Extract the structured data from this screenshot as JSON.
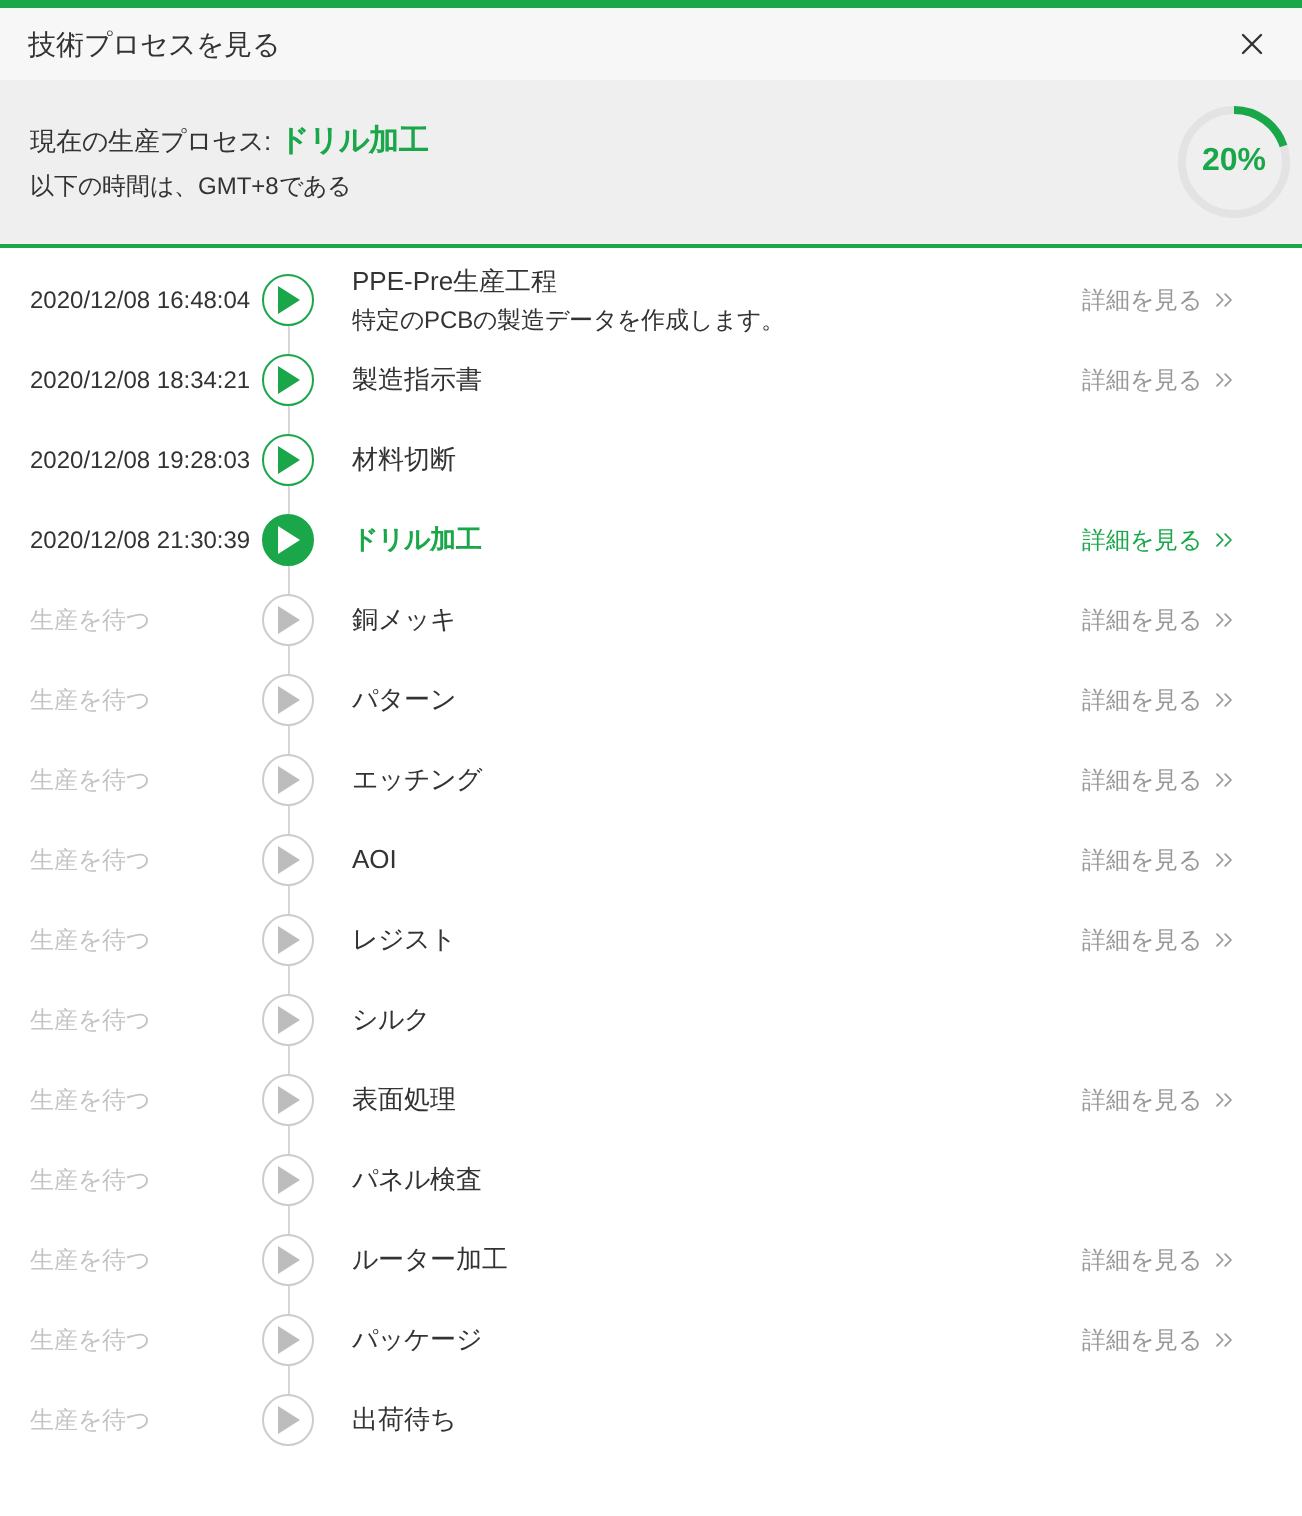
{
  "window": {
    "title": "技術プロセスを見る"
  },
  "summary": {
    "label": "現在の生産プロセス:",
    "current": "ドリル加工",
    "note": "以下の時間は、GMT+8である"
  },
  "progress": {
    "label": "20%"
  },
  "steps": [
    {
      "time": "2020/12/08 16:48:04",
      "name": "PPE-Pre生産工程",
      "description": "特定のPCBの製造データを作成します。",
      "kind": "done",
      "details": "詳細を見る"
    },
    {
      "time": "2020/12/08 18:34:21",
      "name": "製造指示書",
      "kind": "done",
      "details": "詳細を見る"
    },
    {
      "time": "2020/12/08 19:28:03",
      "name": "材料切断",
      "kind": "done"
    },
    {
      "time": "2020/12/08 21:30:39",
      "name": "ドリル加工",
      "kind": "current",
      "details": "詳細を見る"
    },
    {
      "time": "生産を待つ",
      "name": "銅メッキ",
      "kind": "pending",
      "details": "詳細を見る"
    },
    {
      "time": "生産を待つ",
      "name": "パターン",
      "kind": "pending",
      "details": "詳細を見る"
    },
    {
      "time": "生産を待つ",
      "name": "エッチング",
      "kind": "pending",
      "details": "詳細を見る"
    },
    {
      "time": "生産を待つ",
      "name": "AOI",
      "kind": "pending",
      "details": "詳細を見る"
    },
    {
      "time": "生産を待つ",
      "name": "レジスト",
      "kind": "pending",
      "details": "詳細を見る"
    },
    {
      "time": "生産を待つ",
      "name": "シルク",
      "kind": "pending"
    },
    {
      "time": "生産を待つ",
      "name": "表面処理",
      "kind": "pending",
      "details": "詳細を見る"
    },
    {
      "time": "生産を待つ",
      "name": "パネル検査",
      "kind": "pending"
    },
    {
      "time": "生産を待つ",
      "name": "ルーター加工",
      "kind": "pending",
      "details": "詳細を見る"
    },
    {
      "time": "生産を待つ",
      "name": "パッケージ",
      "kind": "pending",
      "details": "詳細を見る"
    },
    {
      "time": "生産を待つ",
      "name": "出荷待ち",
      "kind": "pending"
    }
  ]
}
